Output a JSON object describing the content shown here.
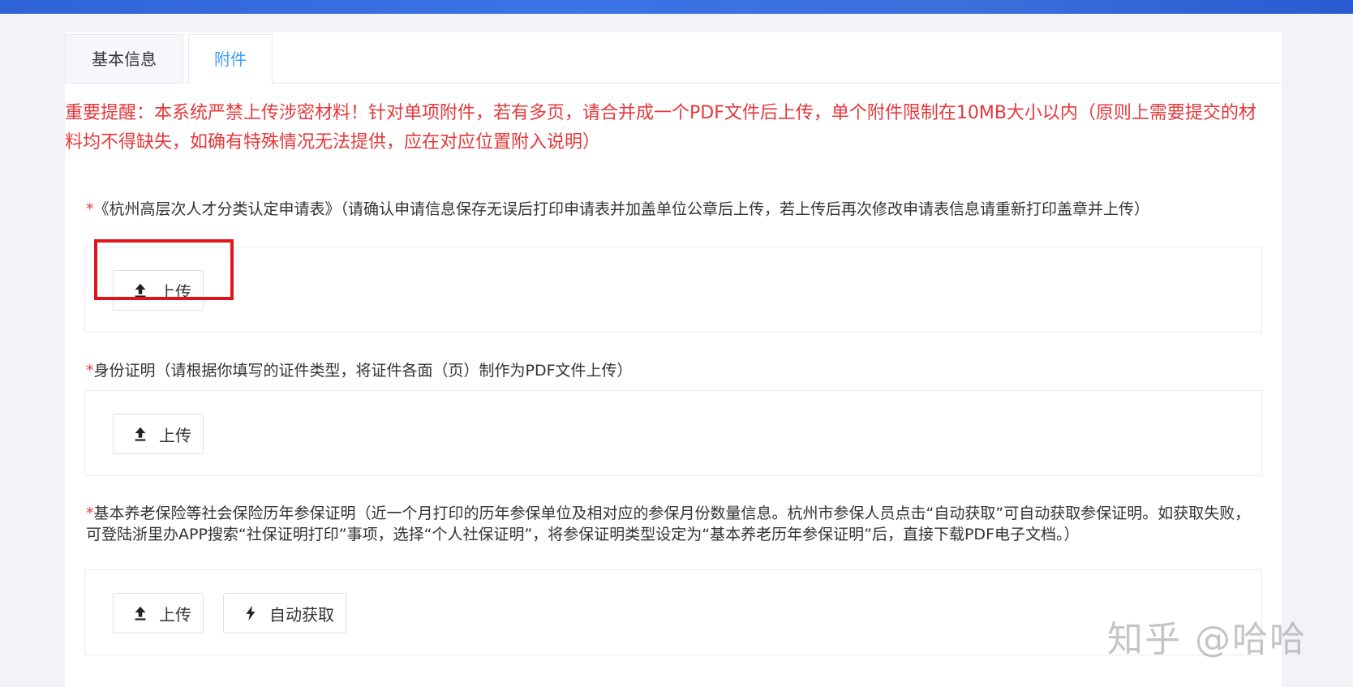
{
  "tabs": [
    {
      "label": "基本信息"
    },
    {
      "label": "附件"
    }
  ],
  "notice": "重要提醒：本系统严禁上传涉密材料！针对单项附件，若有多页，请合并成一个PDF文件后上传，单个附件限制在10MB大小以内（原则上需要提交的材料均不得缺失，如确有特殊情况无法提供，应在对应位置附入说明）",
  "items": [
    {
      "required_mark": "*",
      "label": "《杭州高层次人才分类认定申请表》（请确认申请信息保存无误后打印申请表并加盖单位公章后上传，若上传后再次修改申请表信息请重新打印盖章并上传）",
      "upload_label": "上传"
    },
    {
      "required_mark": "*",
      "label": "身份证明（请根据你填写的证件类型，将证件各面（页）制作为PDF文件上传）",
      "upload_label": "上传"
    },
    {
      "required_mark": "*",
      "label": "基本养老保险等社会保险历年参保证明（近一个月打印的历年参保单位及相对应的参保月份数量信息。杭州市参保人员点击“自动获取”可自动获取参保证明。如获取失败，可登陆浙里办APP搜索“社保证明打印”事项，选择“个人社保证明”，将参保证明类型设定为“基本养老历年参保证明”后，直接下载PDF电子文档。）",
      "upload_label": "上传",
      "auto_label": "自动获取"
    }
  ],
  "watermark": "知乎 @哈哈",
  "colors": {
    "accent": "#409eff",
    "warning_red": "#e5383b",
    "highlight_red": "#e2141a",
    "top_bar": "#3a74e6"
  },
  "icons": [
    "upload-icon",
    "lightning-icon"
  ]
}
